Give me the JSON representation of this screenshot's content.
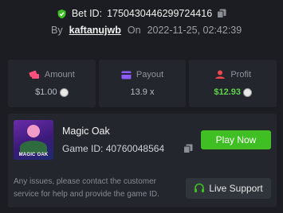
{
  "header": {
    "bet_id_label": "Bet ID:",
    "bet_id": "1750430446299724416",
    "by_label": "By",
    "username": "kaftanujwb",
    "on_label": "On",
    "timestamp": "2022-11-25, 02:42:39"
  },
  "stats": [
    {
      "label": "Amount",
      "value": "$1.00",
      "icon": "money-icon",
      "coin": true
    },
    {
      "label": "Payout",
      "value": "13.9 x",
      "icon": "card-icon",
      "coin": false
    },
    {
      "label": "Profit",
      "value": "$12.93",
      "icon": "profit-icon",
      "coin": true
    }
  ],
  "game": {
    "name": "Magic Oak",
    "thumb_text": "MAGIC OAK",
    "id_label": "Game ID:",
    "id": "40760048564",
    "play_label": "Play Now",
    "note": "Any issues, please contact the customer service for help and provide the game ID.",
    "support_label": "Live Support"
  },
  "colors": {
    "accent_green": "#3fbf23",
    "profit_green": "#5ed34a",
    "icon_pink": "#ff4f7b",
    "icon_purple": "#8b5cf6",
    "icon_red": "#f2464f"
  }
}
